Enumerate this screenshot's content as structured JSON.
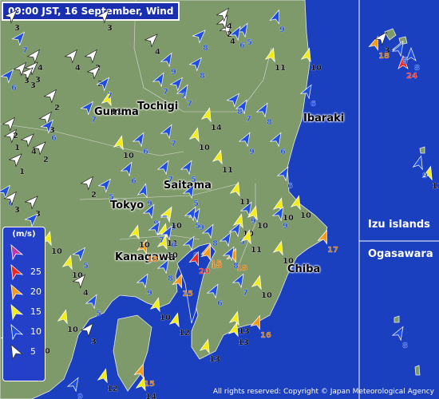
{
  "title": "09:00 JST, 16 September, Wind",
  "copyright": "All rights reserved: Copyright © Japan Meteorological Agency",
  "colors": {
    "sea": "#1a3fbf",
    "land": "#7f9a6a",
    "island_panel": "#ffffff",
    "speed_0_5": "#ffffff",
    "speed_5_10": "#1f4ee0",
    "speed_10_15": "#f2ec18",
    "speed_15_20": "#f39a1d",
    "speed_20_25": "#f2271a",
    "speed_25_plus": "#bb3ca8"
  },
  "prefectures": [
    "Tochigi",
    "Gumma",
    "Ibaraki",
    "Saitama",
    "Tokyo",
    "Kanagawa",
    "Chiba"
  ],
  "islands": [
    "Izu islands",
    "Ogasawara"
  ],
  "legend": {
    "unit": "(m/s)",
    "thresholds": [
      "25",
      "20",
      "15",
      "10",
      "5"
    ],
    "icon": "wind-arrow-icon"
  },
  "stations": [
    {
      "value": "3"
    },
    {
      "value": "9"
    },
    {
      "value": "5"
    },
    {
      "value": "8"
    },
    {
      "value": "3"
    },
    {
      "value": "4"
    },
    {
      "value": "2"
    },
    {
      "value": "7"
    },
    {
      "value": "4"
    },
    {
      "value": "4"
    },
    {
      "value": "2"
    },
    {
      "value": "6"
    },
    {
      "value": "3"
    },
    {
      "value": "4"
    },
    {
      "value": "9"
    },
    {
      "value": "8"
    },
    {
      "value": "6"
    },
    {
      "value": "11"
    },
    {
      "value": "10"
    },
    {
      "value": "18"
    },
    {
      "value": "8"
    },
    {
      "value": "24"
    },
    {
      "value": "2"
    },
    {
      "value": "3"
    },
    {
      "value": "3"
    },
    {
      "value": "7"
    },
    {
      "value": "7"
    },
    {
      "value": "8"
    },
    {
      "value": "2"
    },
    {
      "value": "11"
    },
    {
      "value": "7"
    },
    {
      "value": "3"
    },
    {
      "value": "14"
    },
    {
      "value": "7"
    },
    {
      "value": "6"
    },
    {
      "value": "7"
    },
    {
      "value": "7"
    },
    {
      "value": "2"
    },
    {
      "value": "6"
    },
    {
      "value": "1"
    },
    {
      "value": "4"
    },
    {
      "value": "2"
    },
    {
      "value": "10"
    },
    {
      "value": "10"
    },
    {
      "value": "7"
    },
    {
      "value": "6"
    },
    {
      "value": "9"
    },
    {
      "value": "8"
    },
    {
      "value": "6"
    },
    {
      "value": "1"
    },
    {
      "value": "6"
    },
    {
      "value": "11"
    },
    {
      "value": "5"
    },
    {
      "value": "9"
    },
    {
      "value": "12"
    },
    {
      "value": "2"
    },
    {
      "value": "7"
    },
    {
      "value": "6"
    },
    {
      "value": "3"
    },
    {
      "value": "10"
    },
    {
      "value": "5"
    },
    {
      "value": "5"
    },
    {
      "value": "11"
    },
    {
      "value": "6"
    },
    {
      "value": "5"
    },
    {
      "value": "9"
    },
    {
      "value": "10"
    },
    {
      "value": "10"
    },
    {
      "value": "3"
    },
    {
      "value": "9"
    },
    {
      "value": "9"
    },
    {
      "value": "10"
    },
    {
      "value": "9"
    },
    {
      "value": "5"
    },
    {
      "value": "5"
    },
    {
      "value": "10"
    },
    {
      "value": "9"
    },
    {
      "value": "11"
    },
    {
      "value": "10"
    },
    {
      "value": "17"
    },
    {
      "value": "5"
    },
    {
      "value": "10"
    },
    {
      "value": "10"
    },
    {
      "value": "8"
    },
    {
      "value": "6"
    },
    {
      "value": "18"
    },
    {
      "value": "11"
    },
    {
      "value": "15"
    },
    {
      "value": "10"
    },
    {
      "value": "8"
    },
    {
      "value": "18"
    },
    {
      "value": "18"
    },
    {
      "value": "8"
    },
    {
      "value": "9"
    },
    {
      "value": "20"
    },
    {
      "value": "15"
    },
    {
      "value": "7"
    },
    {
      "value": "10"
    },
    {
      "value": "4"
    },
    {
      "value": "9"
    },
    {
      "value": "5"
    },
    {
      "value": "10"
    },
    {
      "value": "8"
    },
    {
      "value": "10"
    },
    {
      "value": "5"
    },
    {
      "value": "12"
    },
    {
      "value": "8"
    },
    {
      "value": "6"
    },
    {
      "value": "10"
    },
    {
      "value": "12"
    },
    {
      "value": "13"
    },
    {
      "value": "3"
    },
    {
      "value": "16"
    },
    {
      "value": "13"
    },
    {
      "value": "8"
    },
    {
      "value": "13"
    },
    {
      "value": "15"
    },
    {
      "value": "14"
    },
    {
      "value": "9"
    },
    {
      "value": "10"
    },
    {
      "value": "6"
    },
    {
      "value": "3"
    },
    {
      "value": "5"
    },
    {
      "value": "7"
    },
    {
      "value": "6"
    },
    {
      "value": "4"
    }
  ]
}
